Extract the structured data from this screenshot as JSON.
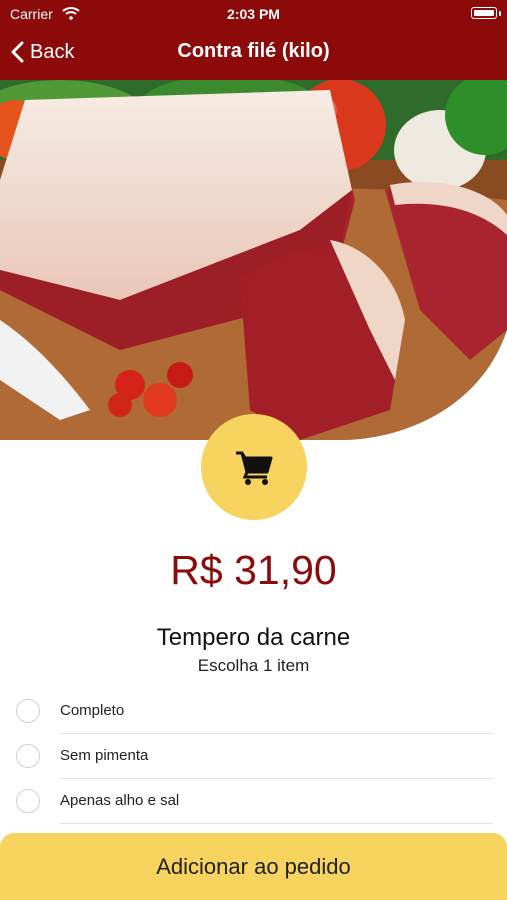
{
  "status_bar": {
    "carrier": "Carrier",
    "time": "2:03 PM"
  },
  "nav": {
    "back_label": "Back",
    "title": "Contra filé (kilo)"
  },
  "product": {
    "price": "R$ 31,90"
  },
  "options_section": {
    "title": "Tempero da carne",
    "subtitle": "Escolha 1 item",
    "options": [
      {
        "label": "Completo"
      },
      {
        "label": "Sem pimenta"
      },
      {
        "label": "Apenas alho e sal"
      }
    ]
  },
  "footer": {
    "add_label": "Adicionar ao pedido"
  },
  "colors": {
    "header": "#8c0a0a",
    "accent": "#f7d35f",
    "price": "#8c0a0a"
  },
  "icons": [
    "wifi-icon",
    "battery-icon",
    "chevron-left-icon",
    "cart-icon"
  ]
}
